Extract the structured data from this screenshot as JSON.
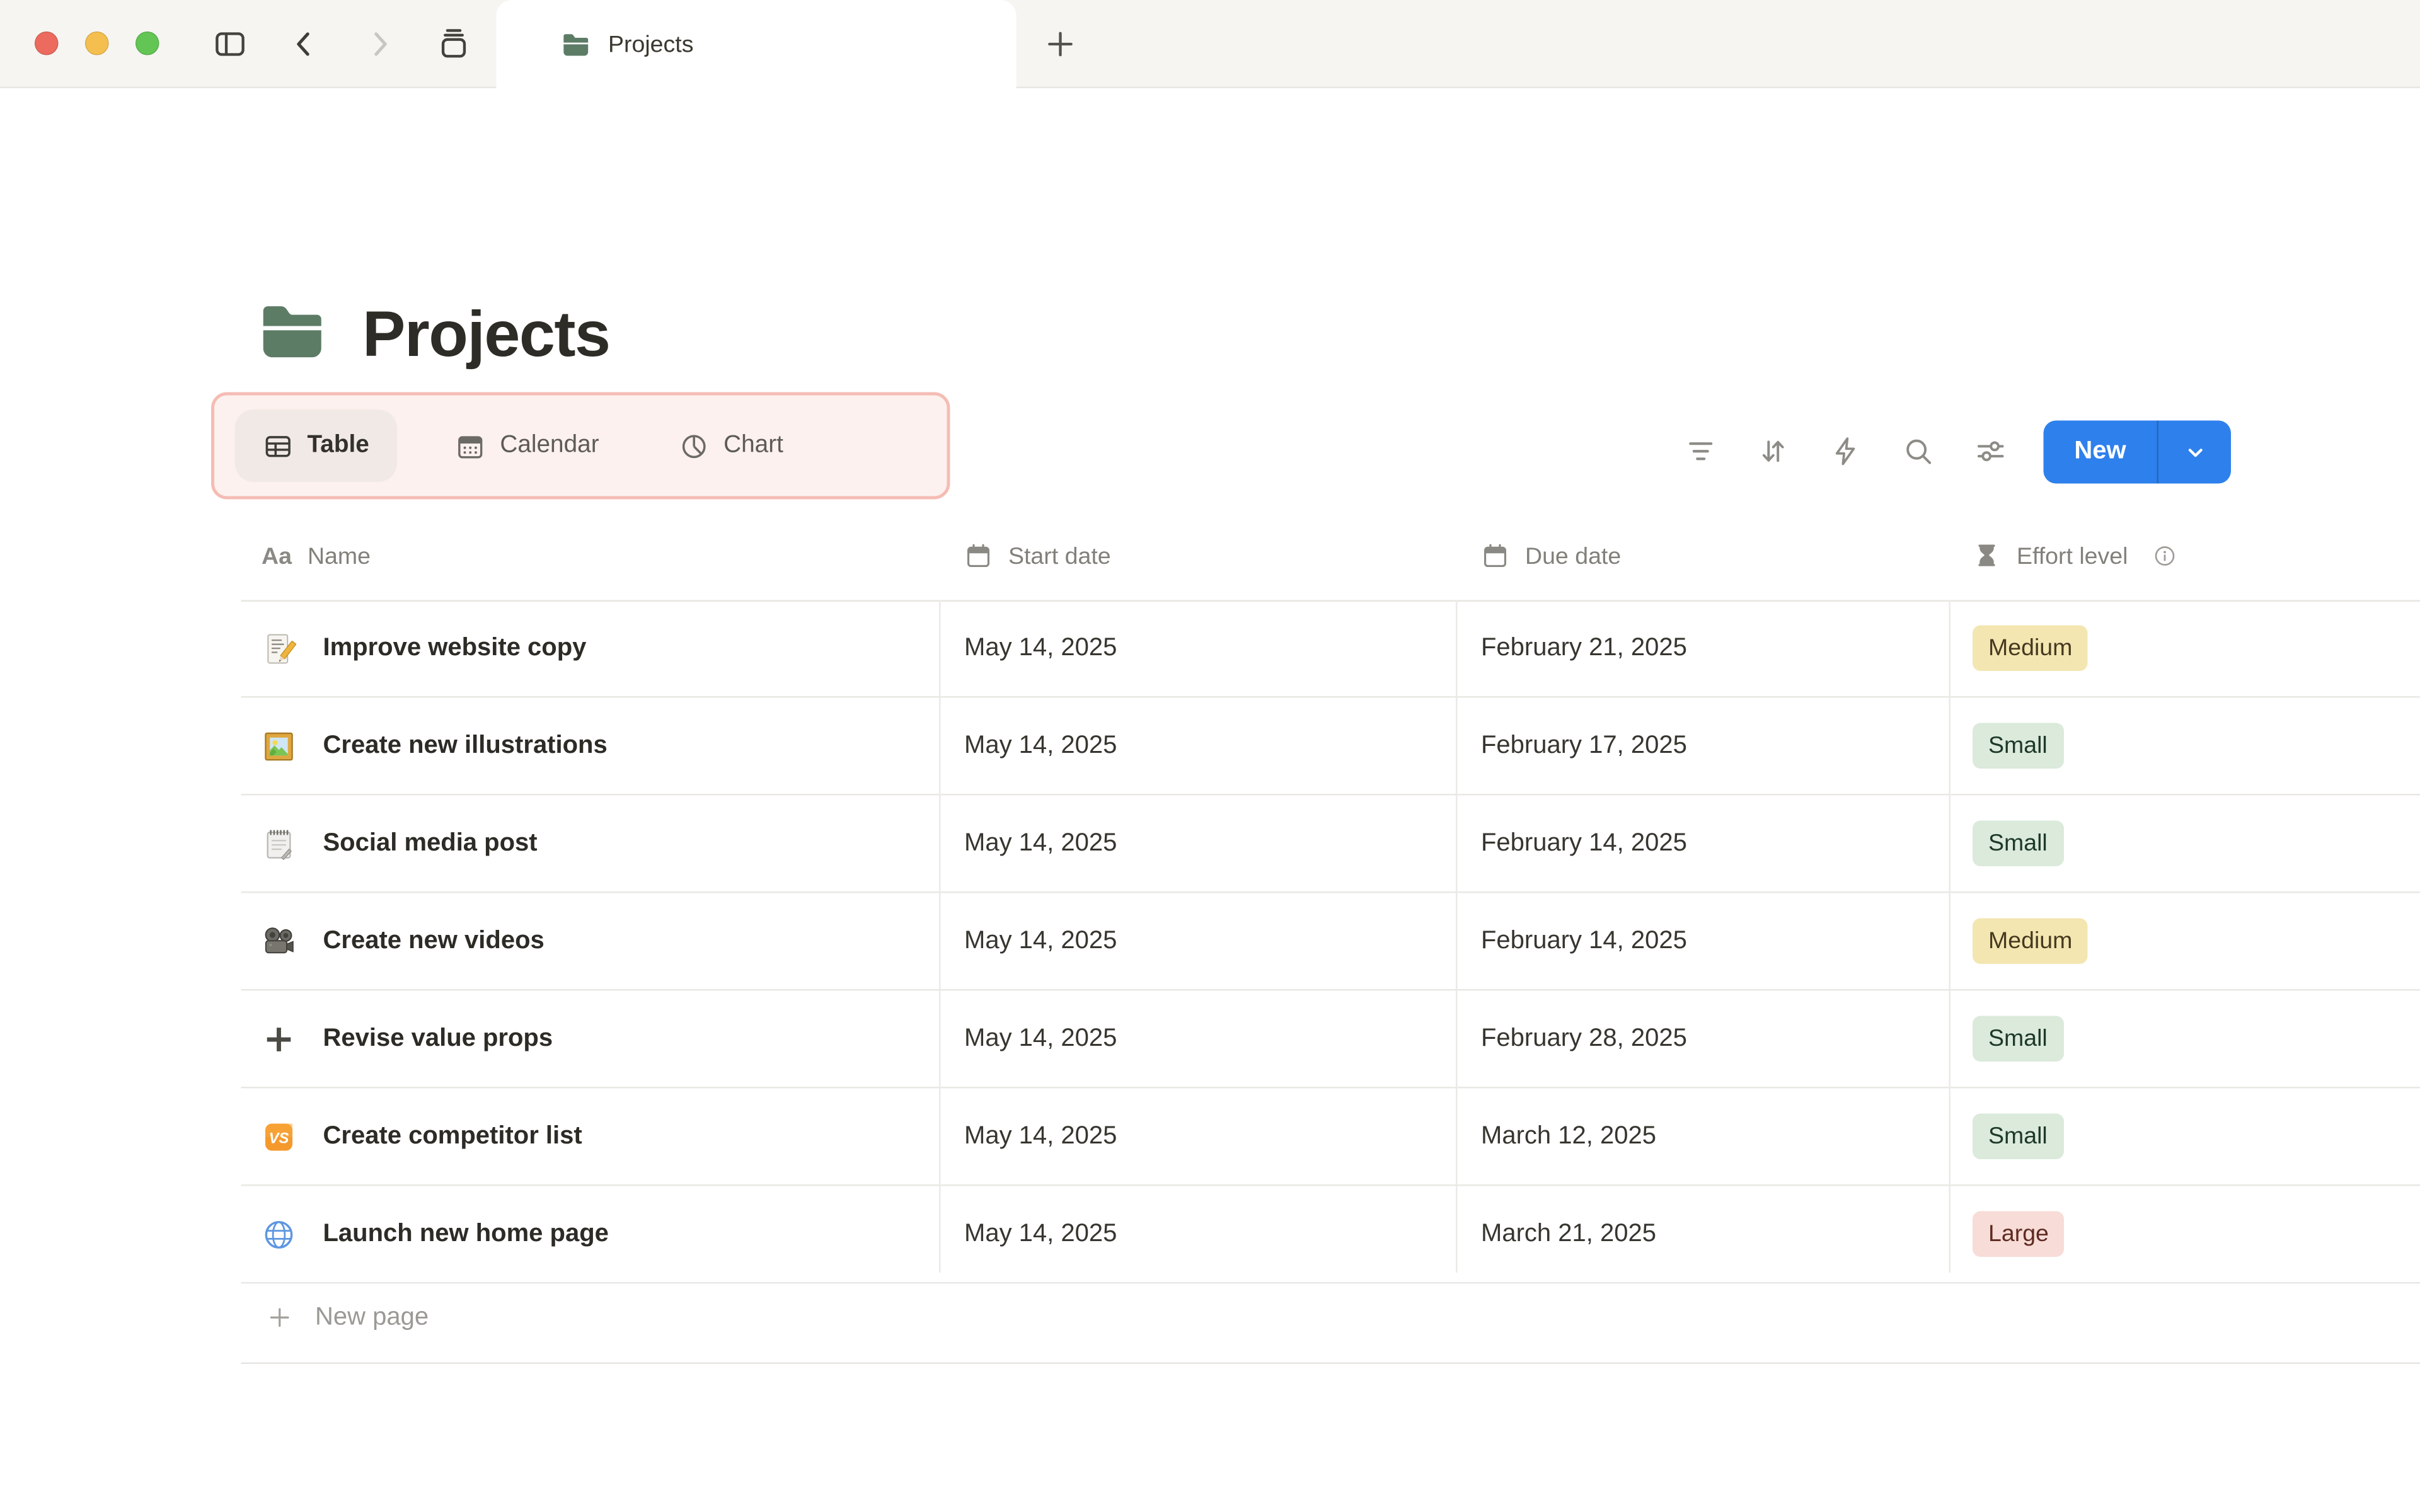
{
  "window": {
    "tab": {
      "title": "Projects",
      "icon": "folder-icon"
    },
    "controls": [
      {
        "name": "close",
        "color": "#ec6a5e"
      },
      {
        "name": "minimize",
        "color": "#f5bf4f"
      },
      {
        "name": "fullscreen",
        "color": "#62c554"
      }
    ]
  },
  "page": {
    "icon": "folder-icon",
    "title": "Projects"
  },
  "views": {
    "tabs": [
      {
        "label": "Table",
        "icon": "table-view-icon",
        "active": true
      },
      {
        "label": "Calendar",
        "icon": "calendar-view-icon",
        "active": false
      },
      {
        "label": "Chart",
        "icon": "pie-chart-icon",
        "active": false
      }
    ]
  },
  "toolbar": {
    "icons": [
      "filter",
      "sort",
      "automations",
      "search",
      "view-settings"
    ],
    "new_button": {
      "label": "New"
    }
  },
  "table": {
    "columns": [
      {
        "label": "Name",
        "icon": "text"
      },
      {
        "label": "Start date",
        "icon": "calendar"
      },
      {
        "label": "Due date",
        "icon": "calendar"
      },
      {
        "label": "Effort level",
        "icon": "hourglass",
        "info": true
      }
    ],
    "rows": [
      {
        "icon": "memo",
        "name": "Improve website copy",
        "start": "May 14, 2025",
        "due": "February 21, 2025",
        "effort": {
          "label": "Medium",
          "color": "yellow"
        }
      },
      {
        "icon": "framed-picture",
        "name": "Create new illustrations",
        "start": "May 14, 2025",
        "due": "February 17, 2025",
        "effort": {
          "label": "Small",
          "color": "green"
        }
      },
      {
        "icon": "spiral-notepad",
        "name": "Social media post",
        "start": "May 14, 2025",
        "due": "February 14, 2025",
        "effort": {
          "label": "Small",
          "color": "green"
        }
      },
      {
        "icon": "movie-camera",
        "name": "Create new videos",
        "start": "May 14, 2025",
        "due": "February 14, 2025",
        "effort": {
          "label": "Medium",
          "color": "yellow"
        }
      },
      {
        "icon": "plus",
        "name": "Revise value props",
        "start": "May 14, 2025",
        "due": "February 28, 2025",
        "effort": {
          "label": "Small",
          "color": "green"
        }
      },
      {
        "icon": "vs",
        "name": "Create competitor list",
        "start": "May 14, 2025",
        "due": "March 12, 2025",
        "effort": {
          "label": "Small",
          "color": "green"
        }
      },
      {
        "icon": "globe",
        "name": "Launch new home page",
        "start": "May 14, 2025",
        "due": "March 21, 2025",
        "effort": {
          "label": "Large",
          "color": "red"
        }
      }
    ],
    "new_row_label": "New page"
  },
  "colors": {
    "accent_blue": "#2e80ec",
    "annotation_fill": "#fcf1ee",
    "annotation_border": "#f5bcb4",
    "folder_green": "#5d7c66",
    "tag_yellow_bg": "#f4e6b1",
    "tag_yellow_text": "#453a20",
    "tag_green_bg": "#dbeadb",
    "tag_green_text": "#1d3829",
    "tag_red_bg": "#f8dcd7",
    "tag_red_text": "#5e2b21"
  }
}
